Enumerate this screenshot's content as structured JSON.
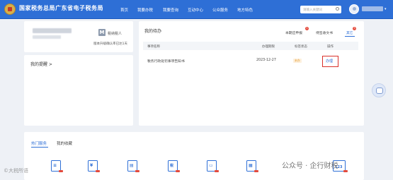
{
  "header": {
    "site_title": "国家税务总局广东省电子税务局",
    "nav": [
      "首页",
      "我要办税",
      "我要查询",
      "互动中心",
      "公众服务",
      "地方特色"
    ],
    "search_placeholder": "请输入关键词",
    "icons": {
      "logo": "tax-emblem-icon",
      "search": "search-icon",
      "avatar": "user-avatar-icon"
    }
  },
  "profile": {
    "badge_letter": "M",
    "taxpayer_type": "税纳税人",
    "note": "版本升级确认率已达1天"
  },
  "reminder": {
    "title": "我的提醒 >"
  },
  "todo": {
    "title": "我的待办",
    "tabs": [
      {
        "label": "本期应申报",
        "badge": "1"
      },
      {
        "label": "待签收文书",
        "badge": ""
      },
      {
        "label": "其它",
        "badge": "3"
      }
    ],
    "columns": [
      "事项名称",
      "办理期限",
      "标签状态",
      "操作"
    ],
    "rows": [
      {
        "name": "税务行政处罚事项告知书",
        "deadline": "2023-12-27",
        "status": "未办",
        "action": "办理"
      }
    ]
  },
  "services": {
    "tabs": [
      "热门服务",
      "我的收藏"
    ],
    "items": [
      {
        "icon": "tax-form-icon",
        "glyph": "≡"
      },
      {
        "icon": "yuan-invoice-icon",
        "glyph": "¥"
      },
      {
        "icon": "document-print-icon",
        "glyph": "▤"
      },
      {
        "icon": "tax-certificate-icon",
        "glyph": "税"
      },
      {
        "icon": "invoice-screen-icon",
        "glyph": "▭"
      },
      {
        "icon": "calendar-form-icon",
        "glyph": "▦"
      },
      {
        "icon": "calculator-123-icon",
        "glyph": "123"
      }
    ]
  },
  "watermarks": {
    "left": "©大税所语",
    "right": "公众号 · 企行财税"
  },
  "colors": {
    "primary": "#2e6fd6",
    "alert": "#d9302a",
    "status_pending": "#e59a2e"
  }
}
